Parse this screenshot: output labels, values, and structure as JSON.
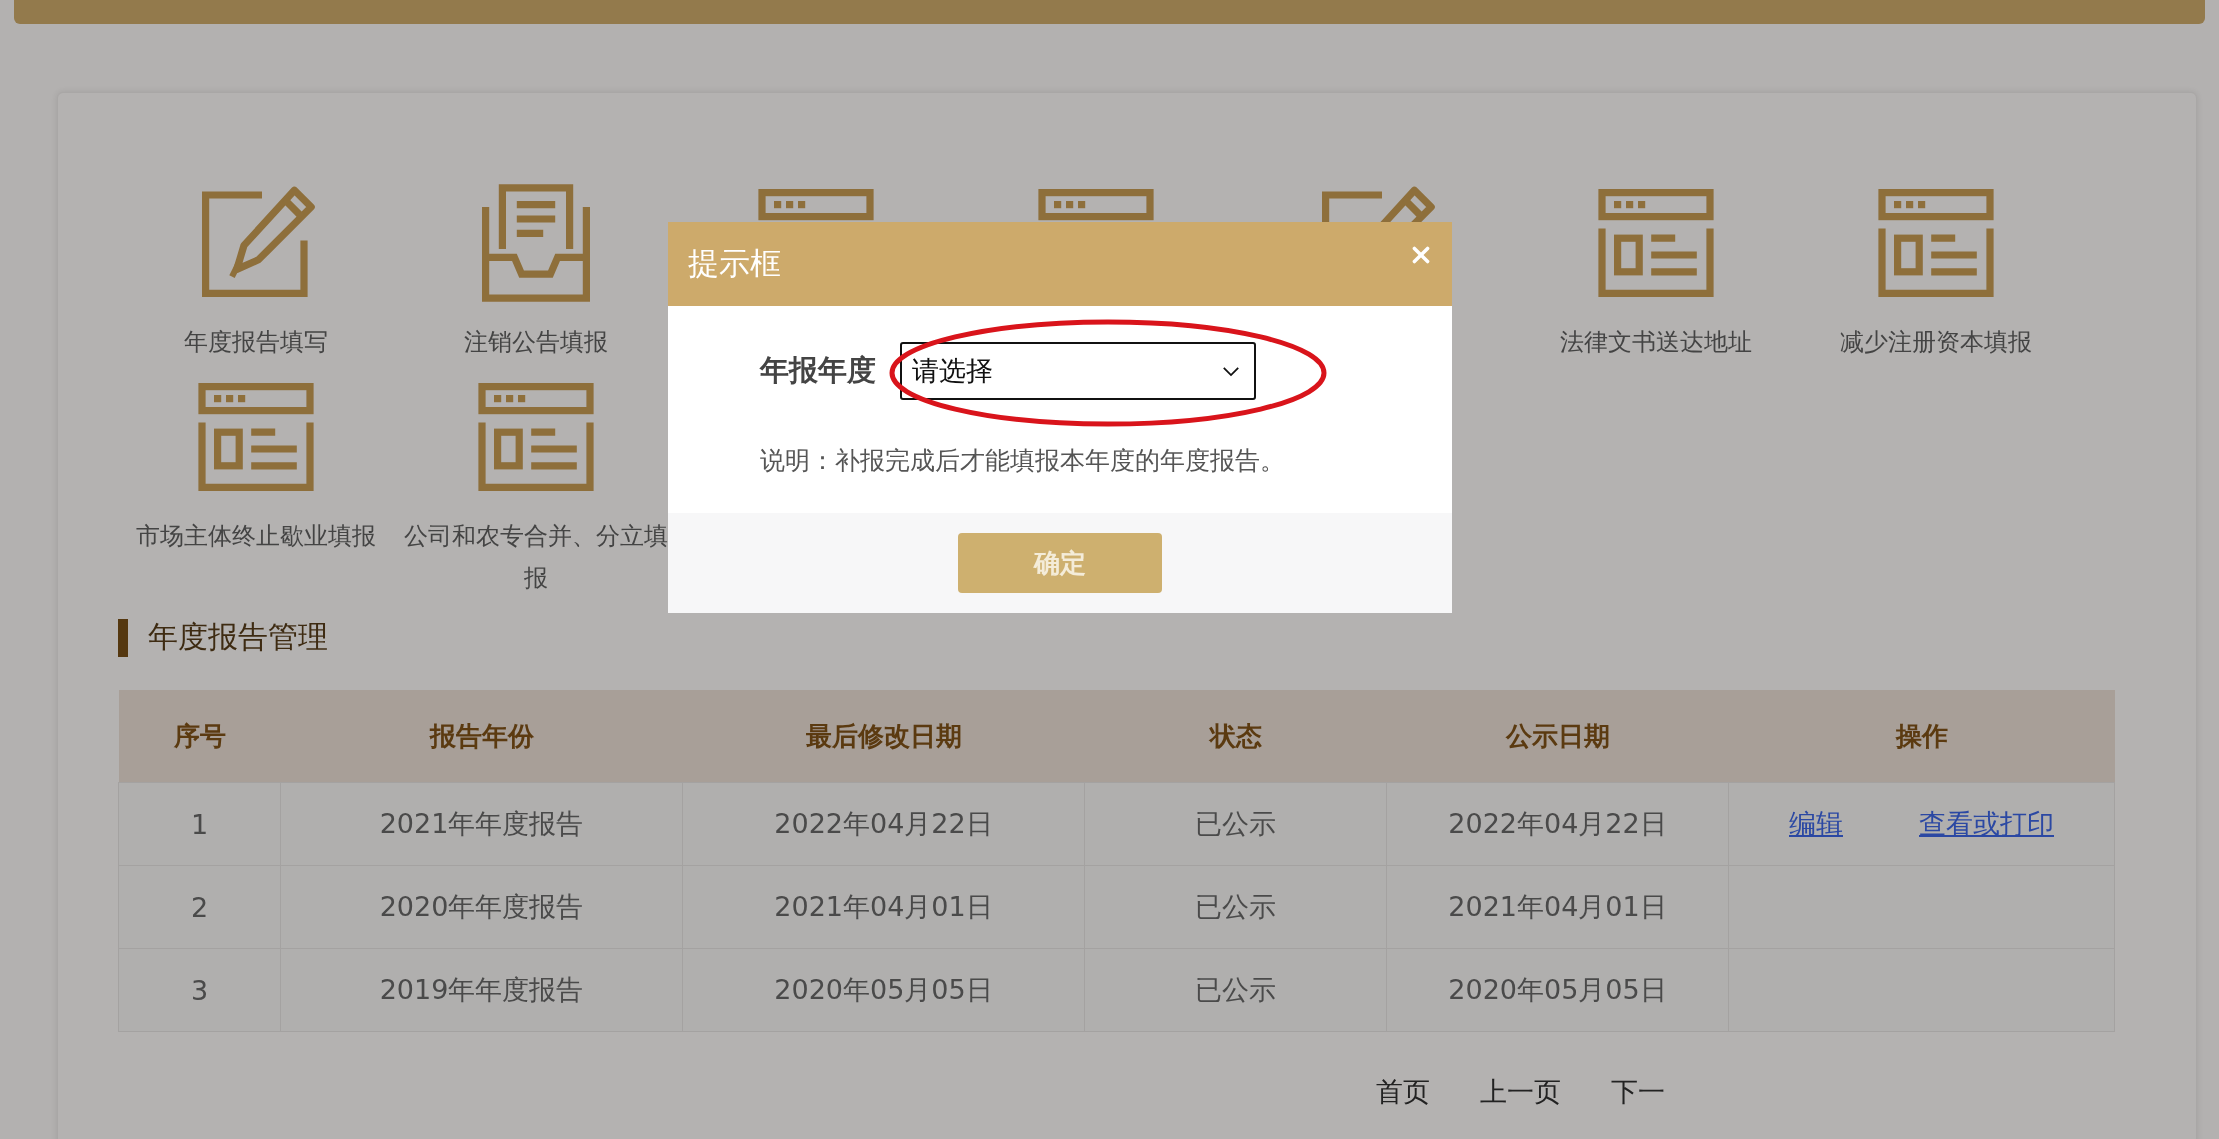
{
  "shortcuts": [
    {
      "kind": "pencil",
      "label": "年度报告填写"
    },
    {
      "kind": "tray",
      "label": "注销公告填报"
    },
    {
      "kind": "form"
    },
    {
      "kind": "form"
    },
    {
      "kind": "pencil"
    },
    {
      "kind": "form",
      "label": "法律文书送达地址"
    },
    {
      "kind": "form",
      "label": "减少注册资本填报"
    },
    {
      "kind": "form",
      "label": "市场主体终止歇业填报"
    },
    {
      "kind": "form",
      "label": "公司和农专合并、分立填报"
    }
  ],
  "section_title": "年度报告管理",
  "table": {
    "columns": [
      "序号",
      "报告年份",
      "最后修改日期",
      "状态",
      "公示日期",
      "操作"
    ],
    "rows": [
      {
        "cells": [
          "1",
          "2021年年度报告",
          "2022年04月22日",
          "已公示",
          "2022年04月22日"
        ],
        "actions": [
          "编辑",
          "查看或打印"
        ]
      },
      {
        "cells": [
          "2",
          "2020年年度报告",
          "2021年04月01日",
          "已公示",
          "2021年04月01日"
        ]
      },
      {
        "cells": [
          "3",
          "2019年年度报告",
          "2020年05月05日",
          "已公示",
          "2020年05月05日"
        ]
      }
    ]
  },
  "pagination": [
    "首页",
    "上一页",
    "下一"
  ],
  "dialog": {
    "title": "提示框",
    "field_label": "年报年度",
    "select": {
      "value": "请选择"
    },
    "note": "说明：补报完成后才能填报本年度的年度报告。",
    "buttons": [
      "确定"
    ],
    "annotation": {
      "kind": "ellipse"
    }
  }
}
